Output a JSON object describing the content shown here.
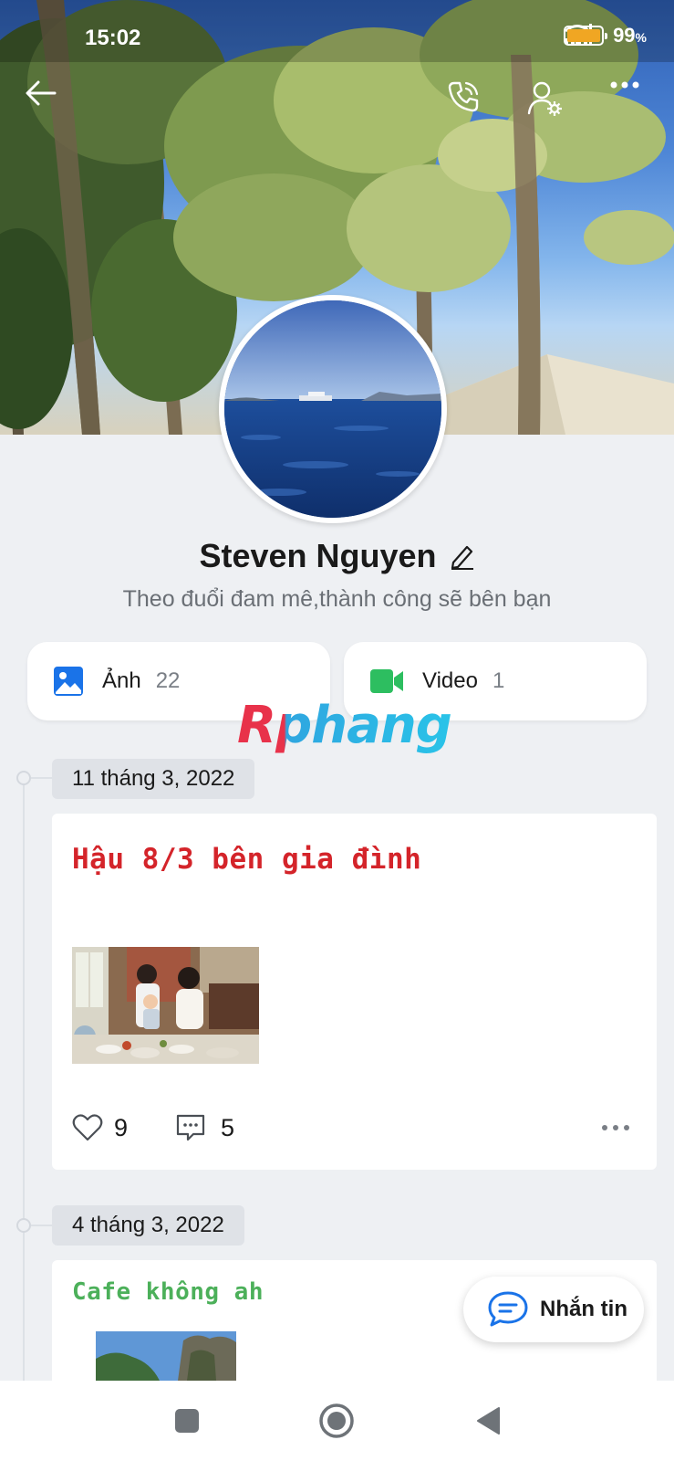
{
  "status_bar": {
    "time": "15:02",
    "battery": "99",
    "battery_unit": "%"
  },
  "profile": {
    "name": "Steven Nguyen",
    "bio": "Theo đuổi đam mê,thành công sẽ bên bạn"
  },
  "media": {
    "photos": {
      "label": "Ảnh",
      "count": "22",
      "icon": "image-icon",
      "color": "#1a73e8"
    },
    "videos": {
      "label": "Video",
      "count": "1",
      "icon": "video-camera-icon",
      "color": "#2dbe60"
    }
  },
  "watermark": "Rphang",
  "timeline": [
    {
      "date": "11 tháng 3, 2022",
      "title": "Hậu 8/3 bên gia đình",
      "title_color": "#d4242a",
      "likes": "9",
      "comments": "5"
    },
    {
      "date": "4 tháng 3, 2022",
      "title": "Cafe không ah",
      "title_color": "#4cb05a"
    }
  ],
  "fab": {
    "label": "Nhắn tin",
    "icon": "chat-bubble-icon"
  },
  "colors": {
    "accent": "#1a73e8",
    "background": "#eef0f3"
  }
}
